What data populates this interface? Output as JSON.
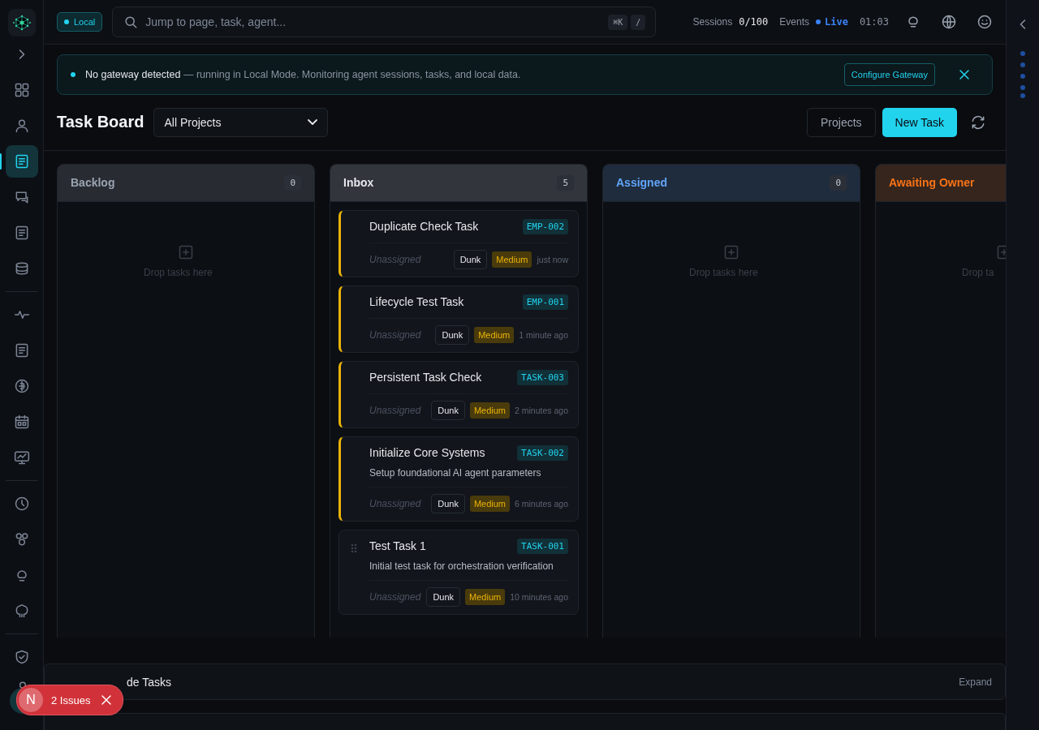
{
  "sidebar": {
    "groups": [
      {
        "items": [
          {
            "selected": false
          },
          {
            "selected": false
          },
          {
            "selected": true
          },
          {
            "selected": false
          },
          {
            "selected": false
          },
          {
            "selected": false
          }
        ]
      },
      {
        "items": [
          {
            "selected": false
          },
          {
            "selected": false
          },
          {
            "selected": false
          },
          {
            "selected": false
          },
          {
            "selected": false
          }
        ]
      },
      {
        "items": [
          {
            "selected": false
          },
          {
            "selected": false
          },
          {
            "selected": false
          },
          {
            "selected": false
          }
        ]
      },
      {
        "items": [
          {
            "selected": false
          }
        ]
      }
    ]
  },
  "top_bar": {
    "mode_badge": "Local",
    "search": {
      "placeholder": "Jump to page, task, agent...",
      "shortcuts": [
        "⌘K",
        "/"
      ]
    },
    "sessions_label": "Sessions",
    "sessions_value": "0/100",
    "events_label": "Events",
    "events_status": "Live",
    "clock": "01:03"
  },
  "banner": {
    "message": "**No gateway detected** — running in Local Mode. Monitoring agent sessions, tasks, and local data.",
    "action": "Configure Gateway"
  },
  "header": {
    "title": "Task Board",
    "project_filter": "All Projects",
    "buttons": [
      "Projects",
      "New Task"
    ]
  },
  "columns": [
    {
      "title": "Backlog",
      "count": "0",
      "color": "#9aa3b0",
      "empty_text": "Drop tasks here"
    },
    {
      "title": "Inbox",
      "count": "5",
      "color": "#e5e7eb",
      "tasks": [
        {
          "title": "Duplicate Check Task",
          "id": "EMP-002",
          "assignee": "Unassigned",
          "owner": "Dunk",
          "priority": "Medium",
          "time": "just now",
          "highlighted": true,
          "handle": false
        },
        {
          "title": "Lifecycle Test Task",
          "id": "EMP-001",
          "assignee": "Unassigned",
          "owner": "Dunk",
          "priority": "Medium",
          "time": "1 minute ago",
          "highlighted": true,
          "handle": false
        },
        {
          "title": "Persistent Task Check",
          "id": "TASK-003",
          "assignee": "Unassigned",
          "owner": "Dunk",
          "priority": "Medium",
          "time": "2 minutes ago",
          "highlighted": true,
          "handle": false
        },
        {
          "title": "Initialize Core Systems",
          "id": "TASK-002",
          "description": "Setup foundational AI agent parameters",
          "assignee": "Unassigned",
          "owner": "Dunk",
          "priority": "Medium",
          "time": "6 minutes ago",
          "highlighted": true,
          "handle": false
        },
        {
          "title": "Test Task 1",
          "id": "TASK-001",
          "description": "Initial test task for orchestration verification",
          "assignee": "Unassigned",
          "owner": "Dunk",
          "priority": "Medium",
          "time": "10 minutes ago",
          "highlighted": false,
          "handle": true
        }
      ]
    },
    {
      "title": "Assigned",
      "count": "0",
      "color": "#60a5fa",
      "empty_text": "Drop tasks here"
    },
    {
      "title": "Awaiting Owner",
      "color": "#f97316",
      "empty_text": "Drop ta"
    }
  ],
  "bottom_panel": {
    "title": "de Tasks",
    "action": "Expand"
  },
  "issues_toast": {
    "logo": "N",
    "label": "2 Issues"
  }
}
